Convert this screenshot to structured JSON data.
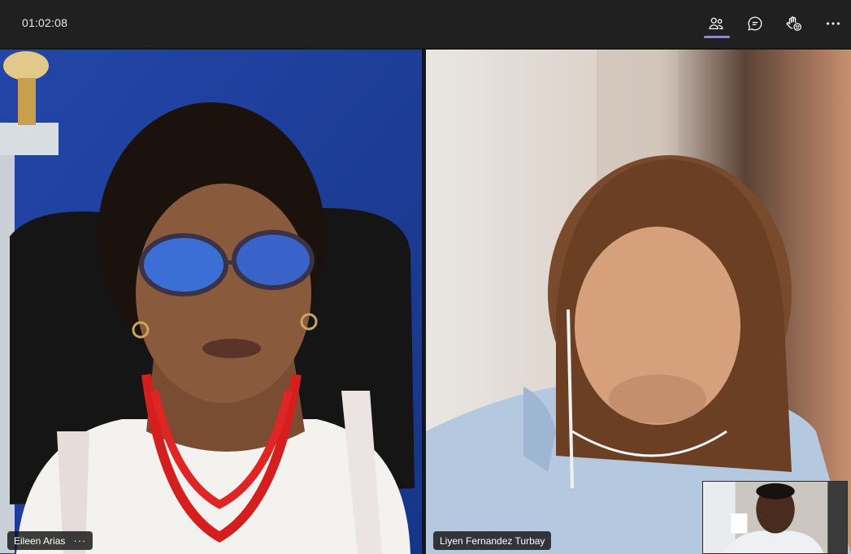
{
  "meeting": {
    "timer": "01:02:08"
  },
  "toolbar": {
    "buttons": [
      {
        "icon": "people-icon",
        "active": true
      },
      {
        "icon": "chat-icon",
        "active": false
      },
      {
        "icon": "reactions-icon",
        "active": false
      },
      {
        "icon": "more-options-icon",
        "active": false
      }
    ],
    "accent": "#8b8cc7"
  },
  "participants": [
    {
      "name": "Eileen Arias",
      "more": "···"
    },
    {
      "name": "Liyen Fernandez Turbay"
    }
  ],
  "colors": {
    "background": "#202020",
    "wall_blue": "#1c3a8f"
  }
}
